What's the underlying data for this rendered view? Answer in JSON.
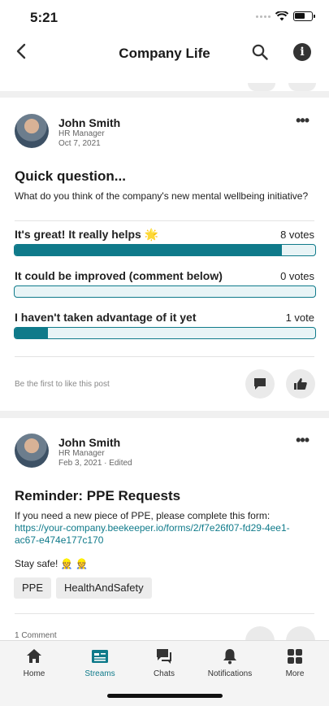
{
  "status_bar": {
    "time": "5:21"
  },
  "navbar": {
    "title": "Company Life"
  },
  "posts": [
    {
      "author": "John Smith",
      "role": "HR Manager",
      "date": "Oct 7, 2021",
      "title": "Quick question...",
      "text": "What do you think of the company's new mental wellbeing initiative?",
      "poll": [
        {
          "label": "It's great! It really helps 🌟",
          "votes": "8 votes",
          "fraction": 0.89
        },
        {
          "label": "It could be improved (comment below)",
          "votes": "0 votes",
          "fraction": 0
        },
        {
          "label": "I haven't taken advantage of it yet",
          "votes": "1 vote",
          "fraction": 0.11
        }
      ],
      "footer_text": "Be the first to like this post"
    },
    {
      "author": "John Smith",
      "role": "HR Manager",
      "date": "Feb 3, 2021 · Edited",
      "title": "Reminder: PPE Requests",
      "text": "If you need a new piece of PPE, please complete this form:",
      "link": "https://your-company.beekeeper.io/forms/2/f7e26f07-fd29-4ee1-ac67-e474e177c170",
      "text2": "Stay safe! 👷 👷",
      "tags": [
        "PPE",
        "HealthAndSafety"
      ],
      "footer_text": "1 Comment"
    }
  ],
  "tabs": [
    {
      "label": "Home",
      "icon": "home-icon"
    },
    {
      "label": "Streams",
      "icon": "streams-icon",
      "active": true
    },
    {
      "label": "Chats",
      "icon": "chats-icon"
    },
    {
      "label": "Notifications",
      "icon": "bell-icon"
    },
    {
      "label": "More",
      "icon": "grid-icon"
    }
  ],
  "colors": {
    "accent": "#0f7a8a",
    "background": "#f0f0f0"
  }
}
